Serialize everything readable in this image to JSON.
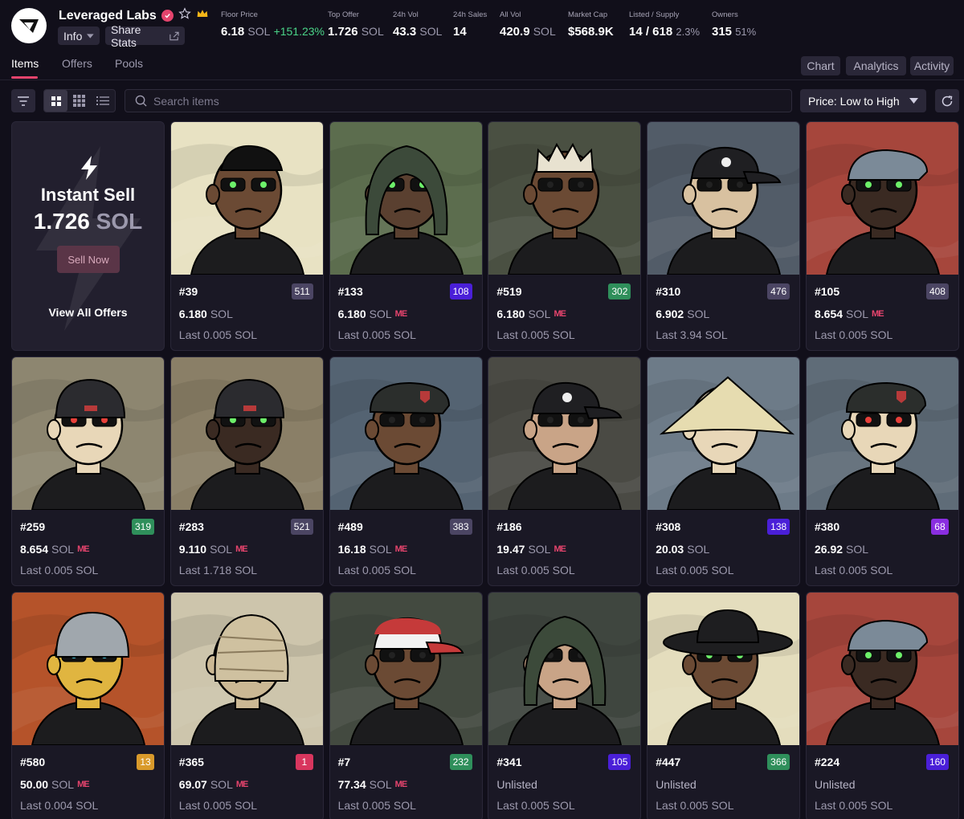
{
  "collection": {
    "name": "Leveraged Labs",
    "info_label": "Info",
    "share_label": "Share Stats"
  },
  "stats": [
    {
      "label": "Floor Price",
      "value": "6.18",
      "unit": "SOL",
      "change": "+151.23%"
    },
    {
      "label": "Top Offer",
      "value": "1.726",
      "unit": "SOL"
    },
    {
      "label": "24h Vol",
      "value": "43.3",
      "unit": "SOL"
    },
    {
      "label": "24h Sales",
      "value": "14"
    },
    {
      "label": "All Vol",
      "value": "420.9",
      "unit": "SOL"
    },
    {
      "label": "Market Cap",
      "value": "$568.9K"
    },
    {
      "label": "Listed / Supply",
      "value": "14 / 618",
      "extra": "2.3%"
    },
    {
      "label": "Owners",
      "value": "315",
      "extra": "51%"
    }
  ],
  "tabs": [
    "Items",
    "Offers",
    "Pools"
  ],
  "right_tabs": [
    "Chart",
    "Analytics",
    "Activity"
  ],
  "search": {
    "placeholder": "Search items"
  },
  "sort": {
    "label": "Price: Low to High"
  },
  "instant_sell": {
    "title": "Instant Sell",
    "price": "1.726",
    "unit": "SOL",
    "button": "Sell Now",
    "link": "View All Offers"
  },
  "colors": {
    "accent": "#e5446d",
    "positive": "#4ad488",
    "rank_gray": "#4b4563",
    "rank_blue": "#4a1fd8",
    "rank_green": "#2f8f5b",
    "rank_purple": "#8a2ee0",
    "rank_orange": "#d99a2b",
    "rank_pink": "#d8365e"
  },
  "items": [
    {
      "id": "#39",
      "rank": "511",
      "rank_color": "gray",
      "price": "6.180",
      "unit": "SOL",
      "marketplace": "",
      "last": "Last 0.005 SOL",
      "bg": "#e8e2c3",
      "skin": "#6b4a34",
      "hat": "none",
      "eyes": "green"
    },
    {
      "id": "#133",
      "rank": "108",
      "rank_color": "blue",
      "price": "6.180",
      "unit": "SOL",
      "marketplace": "ME",
      "last": "Last 0.005 SOL",
      "bg": "#5c6d4e",
      "skin": "#5a4030",
      "hat": "hood",
      "eyes": "green"
    },
    {
      "id": "#519",
      "rank": "302",
      "rank_color": "green",
      "price": "6.180",
      "unit": "SOL",
      "marketplace": "ME",
      "last": "Last 0.005 SOL",
      "bg": "#4a5042",
      "skin": "#6b4a34",
      "hat": "crown",
      "eyes": "dark"
    },
    {
      "id": "#310",
      "rank": "476",
      "rank_color": "gray",
      "price": "6.902",
      "unit": "SOL",
      "marketplace": "",
      "last": "Last 3.94 SOL",
      "bg": "#525c68",
      "skin": "#d8c1a0",
      "hat": "cap",
      "eyes": "dark"
    },
    {
      "id": "#105",
      "rank": "408",
      "rank_color": "gray",
      "price": "8.654",
      "unit": "SOL",
      "marketplace": "ME",
      "last": "Last 0.005 SOL",
      "bg": "#a6463c",
      "skin": "#3a2a22",
      "hat": "flat",
      "eyes": "green"
    },
    {
      "id": "#259",
      "rank": "319",
      "rank_color": "green",
      "price": "8.654",
      "unit": "SOL",
      "marketplace": "ME",
      "last": "Last 0.005 SOL",
      "bg": "#8d8670",
      "skin": "#e8d7b8",
      "hat": "beanie",
      "eyes": "red"
    },
    {
      "id": "#283",
      "rank": "521",
      "rank_color": "gray",
      "price": "9.110",
      "unit": "SOL",
      "marketplace": "ME",
      "last": "Last 1.718 SOL",
      "bg": "#8a7f67",
      "skin": "#3a2a22",
      "hat": "beanie",
      "eyes": "green"
    },
    {
      "id": "#489",
      "rank": "383",
      "rank_color": "gray",
      "price": "16.18",
      "unit": "SOL",
      "marketplace": "ME",
      "last": "Last 0.005 SOL",
      "bg": "#546372",
      "skin": "#6b4a34",
      "hat": "beret",
      "eyes": "dark"
    },
    {
      "id": "#186",
      "rank": "",
      "rank_color": "none",
      "price": "19.47",
      "unit": "SOL",
      "marketplace": "ME",
      "last": "Last 0.005 SOL",
      "bg": "#4a4a44",
      "skin": "#c9a487",
      "hat": "cap",
      "eyes": "dark"
    },
    {
      "id": "#308",
      "rank": "138",
      "rank_color": "blue",
      "price": "20.03",
      "unit": "SOL",
      "marketplace": "",
      "last": "Last 0.005 SOL",
      "bg": "#6d7b88",
      "skin": "#e8d7b8",
      "hat": "straw",
      "eyes": "red"
    },
    {
      "id": "#380",
      "rank": "68",
      "rank_color": "purple",
      "price": "26.92",
      "unit": "SOL",
      "marketplace": "",
      "last": "Last 0.005 SOL",
      "bg": "#5f6c78",
      "skin": "#e8d7b8",
      "hat": "beret",
      "eyes": "red"
    },
    {
      "id": "#580",
      "rank": "13",
      "rank_color": "orange",
      "price": "50.00",
      "unit": "SOL",
      "marketplace": "ME",
      "last": "Last 0.004 SOL",
      "bg": "#b5532a",
      "skin": "#e0b540",
      "hat": "helmet",
      "eyes": "blue"
    },
    {
      "id": "#365",
      "rank": "1",
      "rank_color": "pink",
      "price": "69.07",
      "unit": "SOL",
      "marketplace": "ME",
      "last": "Last 0.005 SOL",
      "bg": "#cdc5ac",
      "skin": "#cbb894",
      "hat": "mummy",
      "eyes": "white"
    },
    {
      "id": "#7",
      "rank": "232",
      "rank_color": "green",
      "price": "77.34",
      "unit": "SOL",
      "marketplace": "ME",
      "last": "Last 0.005 SOL",
      "bg": "#434a40",
      "skin": "#6b4a34",
      "hat": "cap-white",
      "eyes": "dark"
    },
    {
      "id": "#341",
      "rank": "105",
      "rank_color": "blue",
      "price": "Unlisted",
      "unit": "",
      "marketplace": "",
      "last": "Last 0.005 SOL",
      "bg": "#3f463f",
      "skin": "#c9a487",
      "hat": "hood",
      "eyes": "dark"
    },
    {
      "id": "#447",
      "rank": "366",
      "rank_color": "green",
      "price": "Unlisted",
      "unit": "",
      "marketplace": "",
      "last": "Last 0.005 SOL",
      "bg": "#e4ddbd",
      "skin": "#6b4a34",
      "hat": "cowboy",
      "eyes": "green"
    },
    {
      "id": "#224",
      "rank": "160",
      "rank_color": "blue",
      "price": "Unlisted",
      "unit": "",
      "marketplace": "",
      "last": "Last 0.005 SOL",
      "bg": "#a6463c",
      "skin": "#3a2a22",
      "hat": "flat",
      "eyes": "green"
    }
  ]
}
